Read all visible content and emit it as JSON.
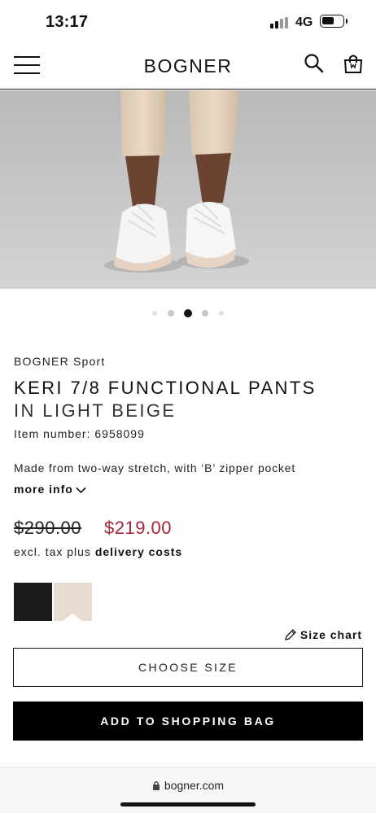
{
  "status_bar": {
    "time": "13:17",
    "network": "4G",
    "battery_level": 0.5
  },
  "header": {
    "brand": "BOGNER",
    "icons": [
      "menu-icon",
      "search-icon",
      "shopping-bag-icon"
    ]
  },
  "gallery": {
    "image_alt": "product-photo-shoes-and-pants",
    "dot_count": 5,
    "active_index": 2
  },
  "product": {
    "brand_line": "BOGNER Sport",
    "title_line1": "KERI 7/8 FUNCTIONAL PANTS",
    "title_line2": "IN LIGHT BEIGE",
    "item_number": "Item number: 6958099",
    "description": "Made from two-way stretch, with ‘B’ zipper pocket",
    "more_info": "more info",
    "old_price": "$290.00",
    "new_price": "$219.00",
    "tax_text": "excl. tax plus",
    "delivery_link": "delivery costs",
    "colors": [
      {
        "name": "black",
        "hex": "#1b1b1b"
      },
      {
        "name": "light beige",
        "hex": "#e6ddd0",
        "selected": true
      }
    ],
    "size_chart": "Size chart",
    "choose_size": "CHOOSE SIZE",
    "add_to_bag": "ADD TO SHOPPING BAG"
  },
  "browser": {
    "url": "bogner.com"
  },
  "colors": {
    "sale_price": "#a5253a",
    "primary_button": "#000000"
  }
}
